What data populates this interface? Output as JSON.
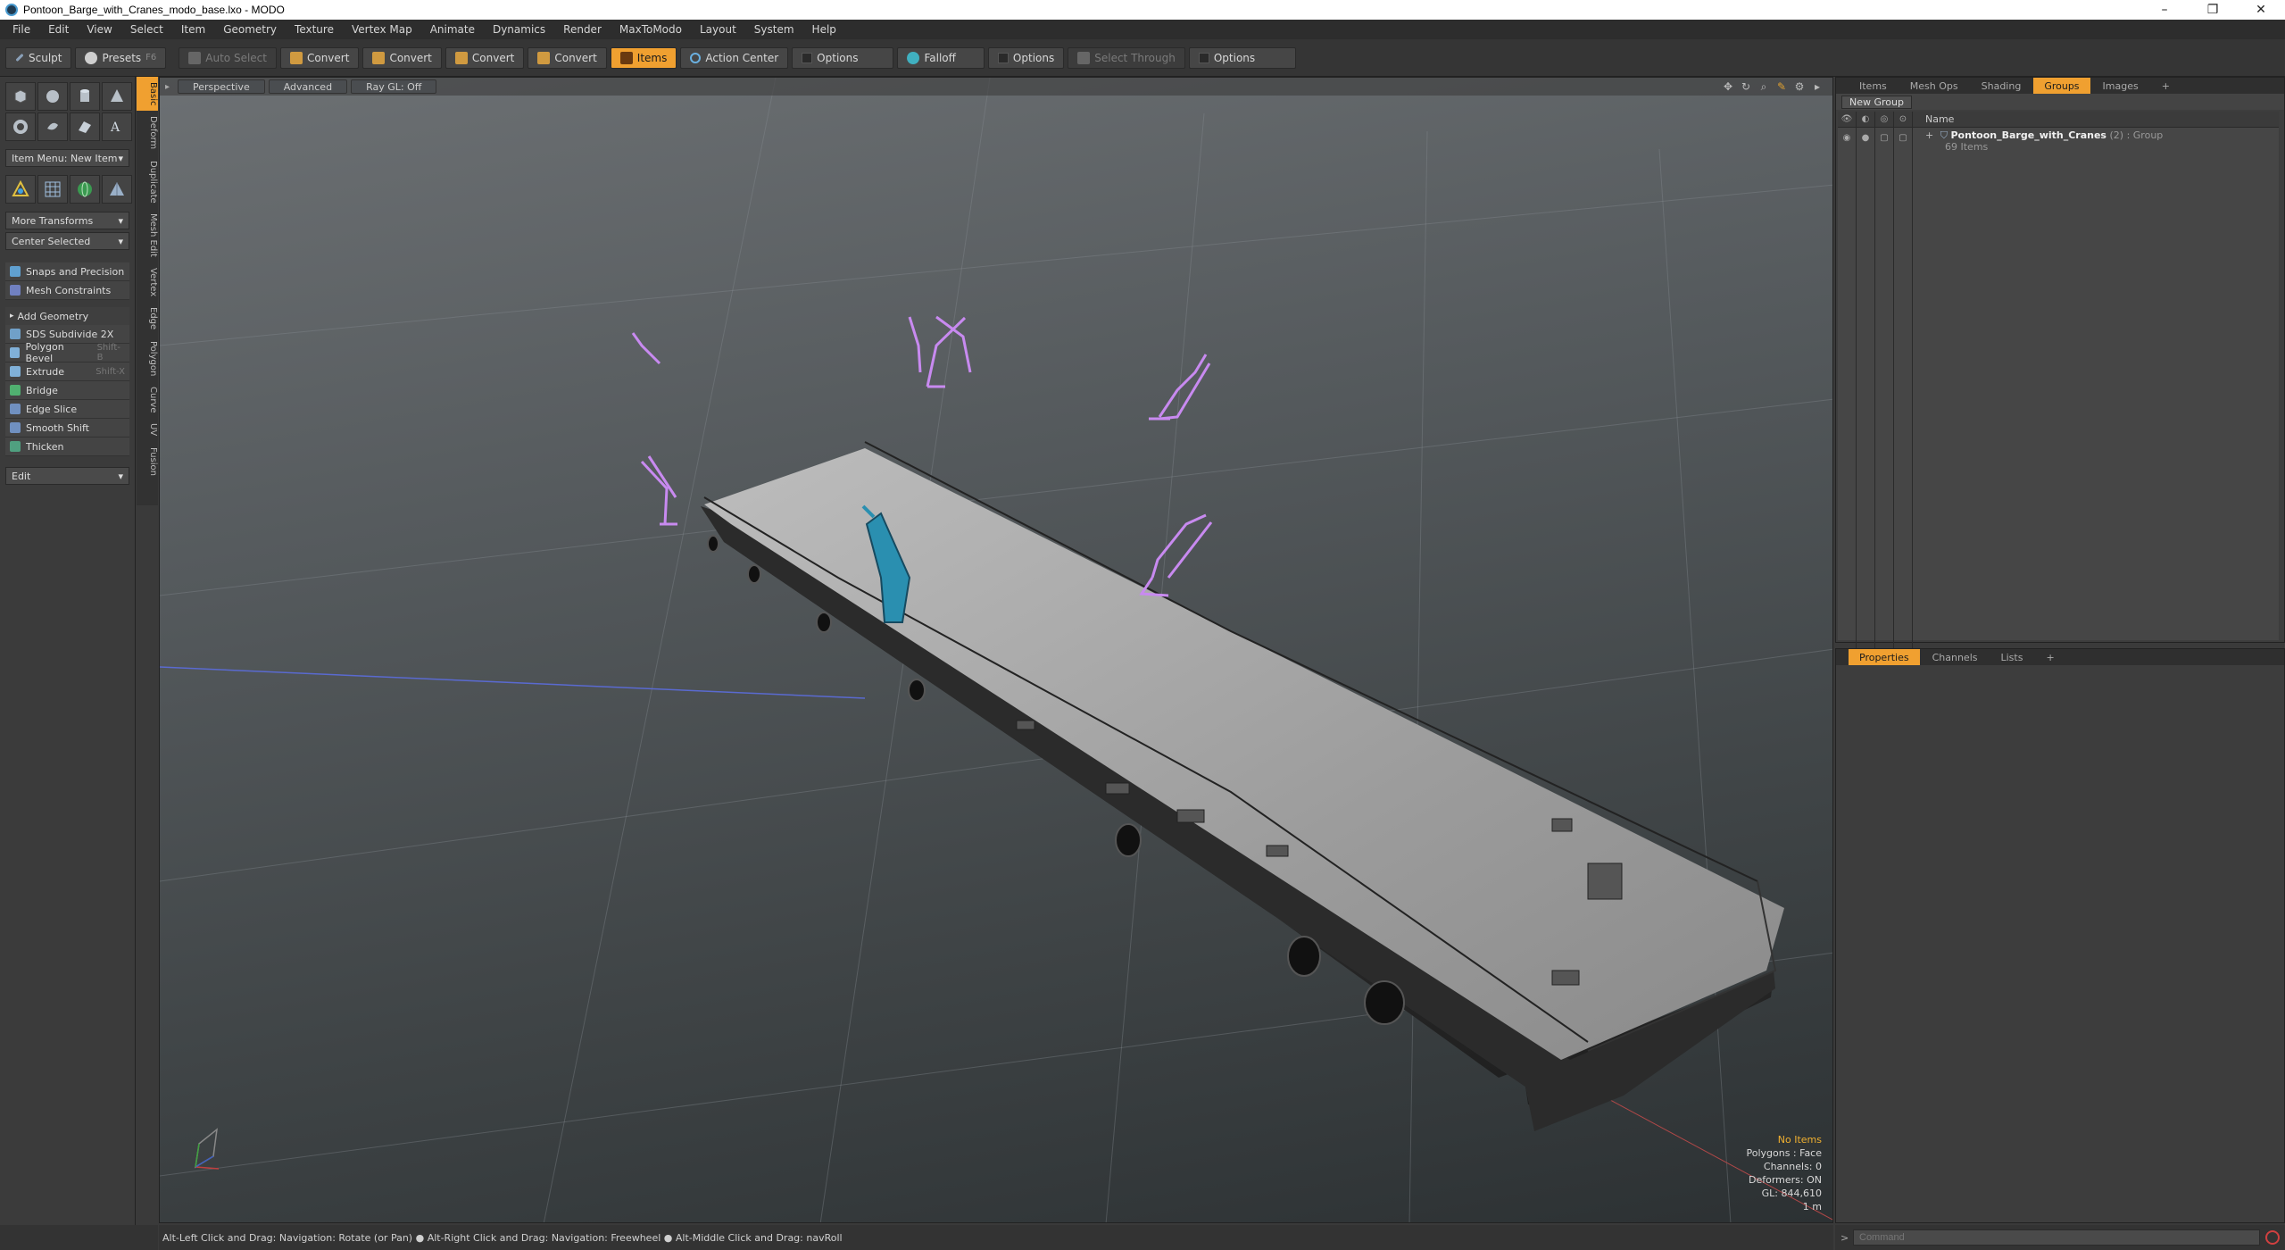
{
  "window": {
    "title": "Pontoon_Barge_with_Cranes_modo_base.lxo - MODO",
    "minimize": "–",
    "maximize": "❐",
    "close": "✕"
  },
  "menu": [
    "File",
    "Edit",
    "View",
    "Select",
    "Item",
    "Geometry",
    "Texture",
    "Vertex Map",
    "Animate",
    "Dynamics",
    "Render",
    "MaxToModo",
    "Layout",
    "System",
    "Help"
  ],
  "toolbar": {
    "sculpt": "Sculpt",
    "presets": "Presets",
    "auto_select": "Auto Select",
    "convert1": "Convert",
    "convert2": "Convert",
    "convert3": "Convert",
    "convert4": "Convert",
    "items": "Items",
    "action_center": "Action Center",
    "options1": "Options",
    "falloff": "Falloff",
    "options2": "Options",
    "select_through": "Select Through",
    "options3": "Options"
  },
  "left_panel": {
    "item_menu": "Item Menu: New Item",
    "more_transforms": "More Transforms",
    "center_selected": "Center Selected",
    "snaps": "Snaps and Precision",
    "mesh_constraints": "Mesh Constraints",
    "add_geometry": "Add Geometry",
    "tools": [
      {
        "label": "SDS Subdivide 2X",
        "shortcut": ""
      },
      {
        "label": "Polygon Bevel",
        "shortcut": "Shift-B"
      },
      {
        "label": "Extrude",
        "shortcut": "Shift-X"
      },
      {
        "label": "Bridge",
        "shortcut": ""
      },
      {
        "label": "Edge Slice",
        "shortcut": ""
      },
      {
        "label": "Smooth Shift",
        "shortcut": ""
      },
      {
        "label": "Thicken",
        "shortcut": ""
      }
    ],
    "edit": "Edit"
  },
  "vertical_tabs": [
    "Basic",
    "Deform",
    "Duplicate",
    "Mesh Edit",
    "Vertex",
    "Edge",
    "Polygon",
    "Curve",
    "UV",
    "Fusion"
  ],
  "viewport": {
    "tabs": [
      "Perspective",
      "Advanced",
      "Ray GL: Off"
    ],
    "info": {
      "no_items": "No Items",
      "polygons": "Polygons : Face",
      "channels": "Channels: 0",
      "deformers": "Deformers: ON",
      "gl": "GL: 844,610",
      "scale": "1 m"
    }
  },
  "right_top": {
    "tabs": [
      "Items",
      "Mesh Ops",
      "Shading",
      "Groups",
      "Images"
    ],
    "add_tab": "+",
    "new_group": "New Group",
    "col_name": "Name",
    "group": {
      "expand": "+",
      "name": "Pontoon_Barge_with_Cranes",
      "count": "(2)",
      "type": ": Group",
      "items": "69 Items"
    }
  },
  "right_bottom": {
    "tabs": [
      "Properties",
      "Channels",
      "Lists"
    ],
    "add_tab": "+"
  },
  "statusbar": {
    "hint": "Alt-Left Click and Drag: Navigation: Rotate (or Pan) ● Alt-Right Click and Drag: Navigation: Freewheel ● Alt-Middle Click and Drag: navRoll"
  },
  "command": {
    "prompt": ">",
    "placeholder": "Command"
  },
  "colors": {
    "accent": "#f0a030",
    "crane_purple": "#c88af0",
    "crane_teal": "#2a8fb0"
  }
}
